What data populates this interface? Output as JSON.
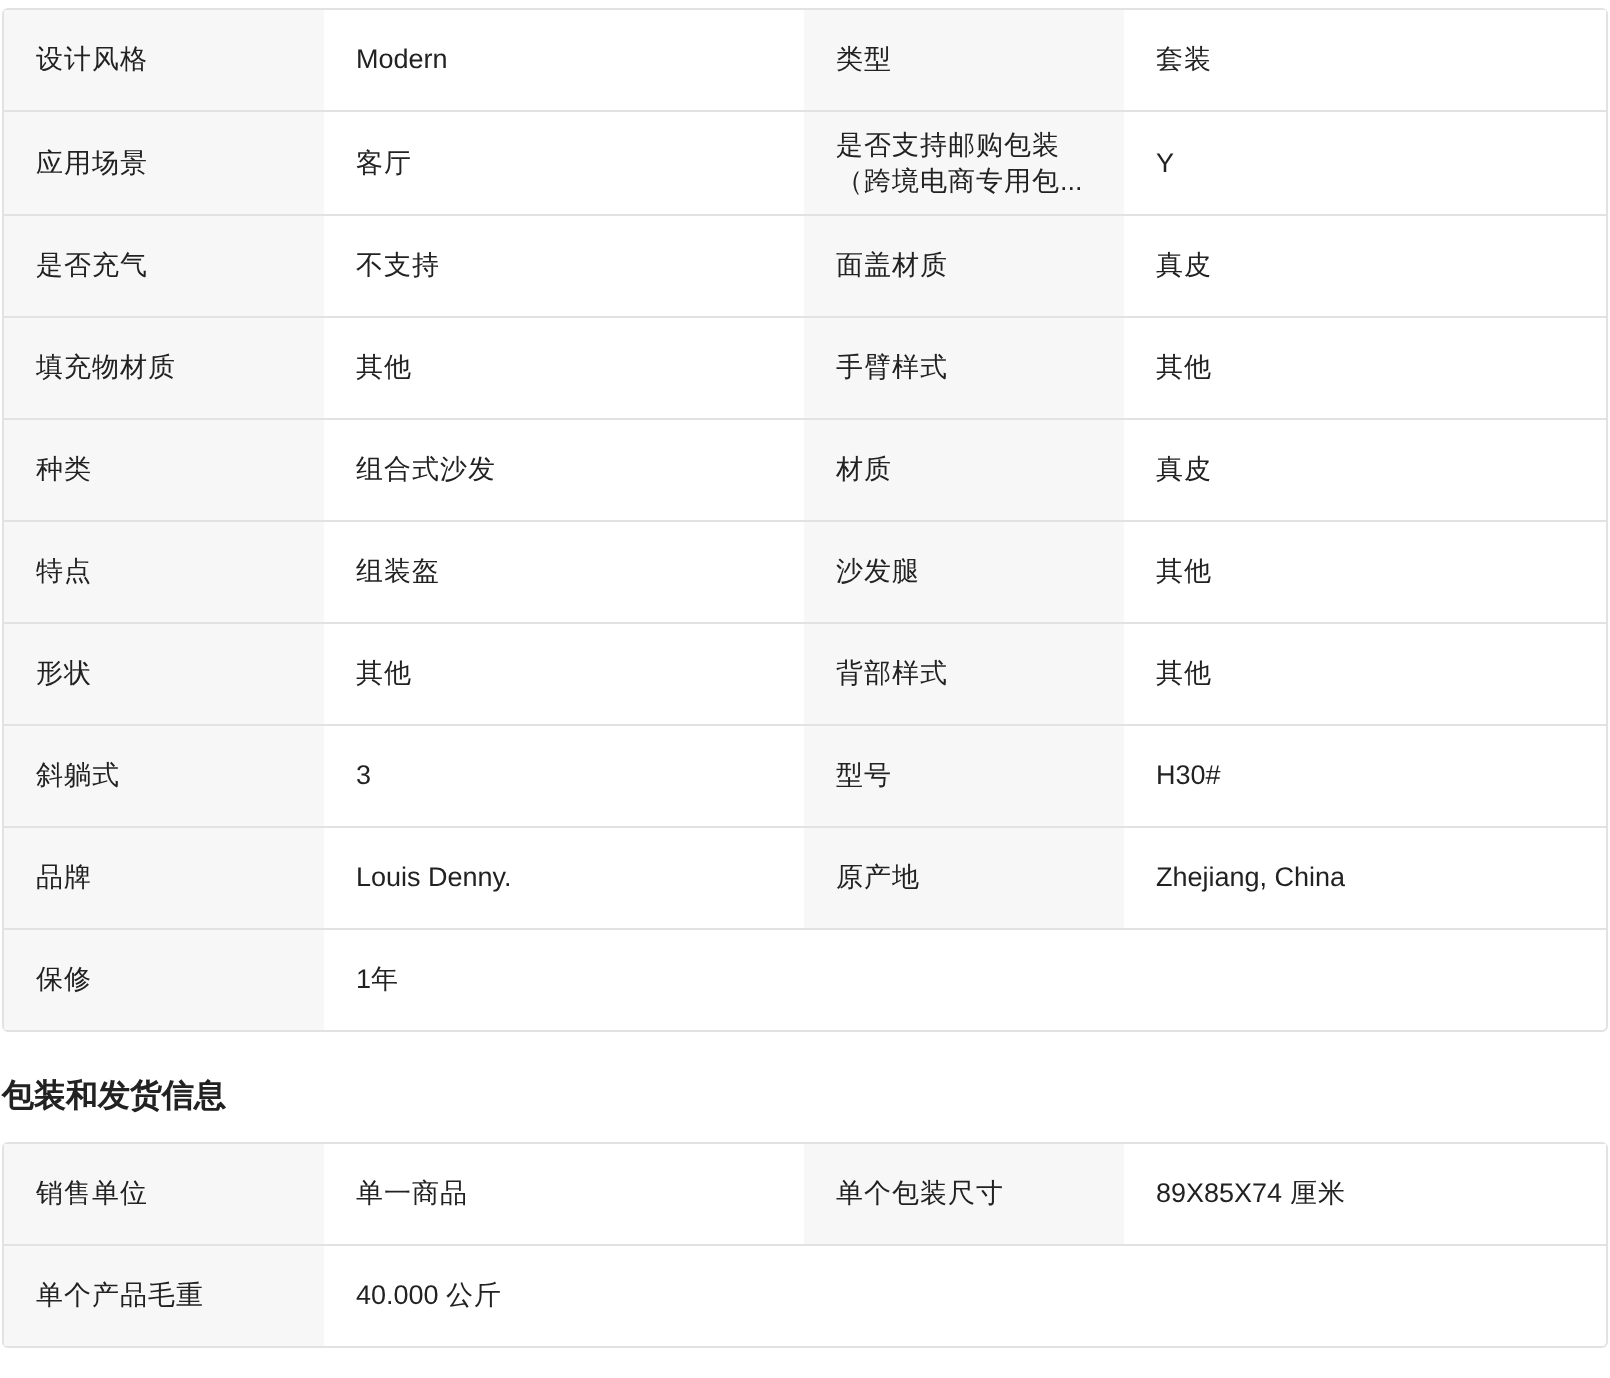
{
  "specs": {
    "rows": [
      {
        "pairs": [
          {
            "label": "设计风格",
            "value": "Modern"
          },
          {
            "label": "类型",
            "value": "套装"
          }
        ]
      },
      {
        "pairs": [
          {
            "label": "应用场景",
            "value": "客厅"
          },
          {
            "label": "是否支持邮购包装（跨境电商专用包...",
            "value": "Y"
          }
        ]
      },
      {
        "pairs": [
          {
            "label": "是否充气",
            "value": "不支持"
          },
          {
            "label": "面盖材质",
            "value": "真皮"
          }
        ]
      },
      {
        "pairs": [
          {
            "label": "填充物材质",
            "value": "其他"
          },
          {
            "label": "手臂样式",
            "value": "其他"
          }
        ]
      },
      {
        "pairs": [
          {
            "label": "种类",
            "value": "组合式沙发"
          },
          {
            "label": "材质",
            "value": "真皮"
          }
        ]
      },
      {
        "pairs": [
          {
            "label": "特点",
            "value": "组装盔"
          },
          {
            "label": "沙发腿",
            "value": "其他"
          }
        ]
      },
      {
        "pairs": [
          {
            "label": "形状",
            "value": "其他"
          },
          {
            "label": "背部样式",
            "value": "其他"
          }
        ]
      },
      {
        "pairs": [
          {
            "label": "斜躺式",
            "value": "3"
          },
          {
            "label": "型号",
            "value": "H30#"
          }
        ]
      },
      {
        "pairs": [
          {
            "label": "品牌",
            "value": "Louis Denny."
          },
          {
            "label": "原产地",
            "value": "Zhejiang, China"
          }
        ]
      },
      {
        "pairs": [
          {
            "label": "保修",
            "value": "1年"
          }
        ]
      }
    ]
  },
  "packaging": {
    "title": "包装和发货信息",
    "rows": [
      {
        "pairs": [
          {
            "label": "销售单位",
            "value": "单一商品"
          },
          {
            "label": "单个包装尺寸",
            "value": "89X85X74 厘米"
          }
        ]
      },
      {
        "pairs": [
          {
            "label": "单个产品毛重",
            "value": "40.000 公斤"
          }
        ]
      }
    ]
  }
}
